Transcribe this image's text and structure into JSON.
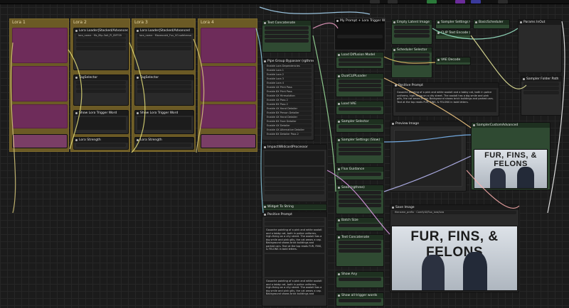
{
  "lora_groups": [
    {
      "title": "Lora 1"
    },
    {
      "title": "Lora 2"
    },
    {
      "title": "Lora 3"
    },
    {
      "title": "Lora 4"
    }
  ],
  "nodes": {
    "lora_loader_2": "Lora Loader|Stacked/Advanced",
    "lora_loader_3": "Lora Loader|Stacked/Advanced",
    "lora_2_name": "lora_name · Ms_Mip-3ait_Pl_EMT09",
    "lora_3_name": "lora_name · Mavexcold_Fux_VO.safetensors",
    "tag_selector": "TagSelector",
    "show_trigger": "Show Lora Trigger Word",
    "lora_strength": "Lora Strength",
    "text_concatenate": "Text Concatenate",
    "pipe_group_bypasser": "Pipe Group Bypasser (rgthree)",
    "load_diffusion_model": "Load Diffusion Model",
    "dual_clip_loader": "DualCLIPLoader",
    "load_vae": "Load VAE",
    "sampler_selector": "Sampler Selector",
    "scheduler_selector": "Scheduler Selector",
    "sampler_settings": "Sampler Settings (Slow)",
    "flux_guidance": "Flux Guidance",
    "seed": "Seed (rgthree)",
    "batch_size": "Batch Size",
    "empty_latent": "Empty Latent Image",
    "vae_decode": "VAE Decode",
    "sampler_custom": "SamplerCustomAdvanced",
    "save_image": "Save Image",
    "image_preview": "Preview Image",
    "positive_prompt": "Positive Prompt",
    "impact_wildcard": "ImpactWildcardProcessor",
    "show_any": "Show Any",
    "widget_to_string": "Widget To String",
    "parse_input": "Params InOut",
    "sampler_folder": "Sampler Folder Path",
    "my_prompt": "My Prompt + Lora Trigger Words",
    "cliptext_encode": "CLIP Text Encode (Pr...)",
    "sampler_settings_2": "Sampler Settings Out",
    "upscale_model": "BasicScheduler",
    "filename": "filename_prefix · ComfyUI/flux_lora/lora",
    "show_all_trigger": "Show all trigger words",
    "bypasser_items": [
      "Enable Lora Dependencies",
      "Enable Lora 1",
      "Enable Lora 2",
      "Enable Lora 3",
      "Enable Lora 4",
      "Enable 4X Print Pass",
      "Enable 8X Print Pass",
      "Enable 4X Hiresolution",
      "Enable 4X Pass 2",
      "Enable 8X Pass 2",
      "Enable 4X Hand Detailer",
      "Enable 8X Person Detailer",
      "Enable 4X Hand Detailer",
      "Enable 8X Face Detailer",
      "Enable 4X Detailer",
      "Enable 4X Alternative Detailer",
      "Enable 8X Detailer Pass 2"
    ],
    "prompt_text": "Gouache painting of a pink and white axolotl and a tabby cat, both in police uniforms, high-fiving on a city street. The axolotl has a big smile and pink gills, the cat wears a cap. Background shows brick buildings and parked cars. Text at the top reads FUR, FINS, & FELONS in bold letters."
  },
  "poster_small": {
    "title": "FUR, FINS, & FELONS"
  },
  "poster_large": {
    "title": "FUR, FINS, & FELONS"
  },
  "colors": {
    "group": "#6b5a25",
    "node": "#2f3a2e",
    "pink": "#6e2c5a",
    "background": "#1b1b1b"
  }
}
